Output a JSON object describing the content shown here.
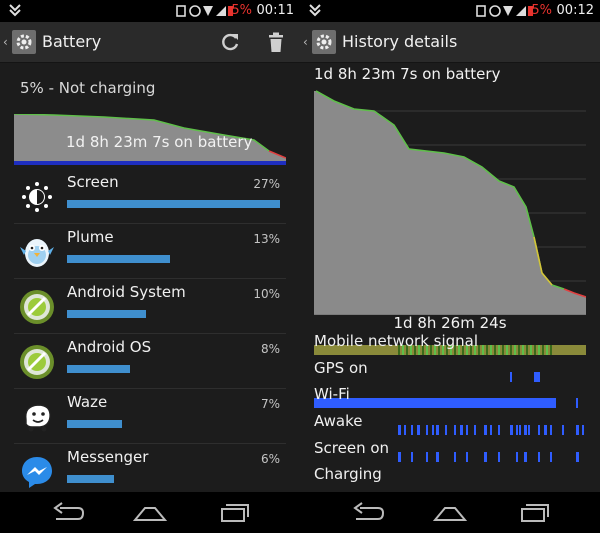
{
  "status_bar": {
    "left": {
      "battery_text": "5%",
      "time": "00:11"
    },
    "right": {
      "battery_text": "5%",
      "time": "00:12"
    }
  },
  "battery_screen": {
    "title": "Battery",
    "status": "5% - Not charging",
    "chart_label": "1d 8h 23m 7s on battery",
    "items": [
      {
        "name": "Screen",
        "percent": "27%",
        "level": 27,
        "icon": "screen-brightness-icon"
      },
      {
        "name": "Plume",
        "percent": "13%",
        "level": 13,
        "icon": "plume-bird-icon"
      },
      {
        "name": "Android System",
        "percent": "10%",
        "level": 10,
        "icon": "android-system-icon"
      },
      {
        "name": "Android OS",
        "percent": "8%",
        "level": 8,
        "icon": "android-os-icon"
      },
      {
        "name": "Waze",
        "percent": "7%",
        "level": 7,
        "icon": "waze-icon"
      },
      {
        "name": "Messenger",
        "percent": "6%",
        "level": 6,
        "icon": "messenger-icon"
      }
    ]
  },
  "history_screen": {
    "title": "History details",
    "chart_label": "1d 8h 23m 7s on battery",
    "duration": "1d 8h 26m 24s",
    "signals": [
      "Mobile network signal",
      "GPS on",
      "Wi-Fi",
      "Awake",
      "Screen on",
      "Charging"
    ]
  },
  "colors": {
    "bar": "#3f8fce",
    "battery_fill": "#8a8a8a",
    "battery_line_good": "#5fbf4a",
    "battery_line_low": "#e04040",
    "wifi_strip": "#2f5dff",
    "low_battery_text": "#e8332e"
  }
}
